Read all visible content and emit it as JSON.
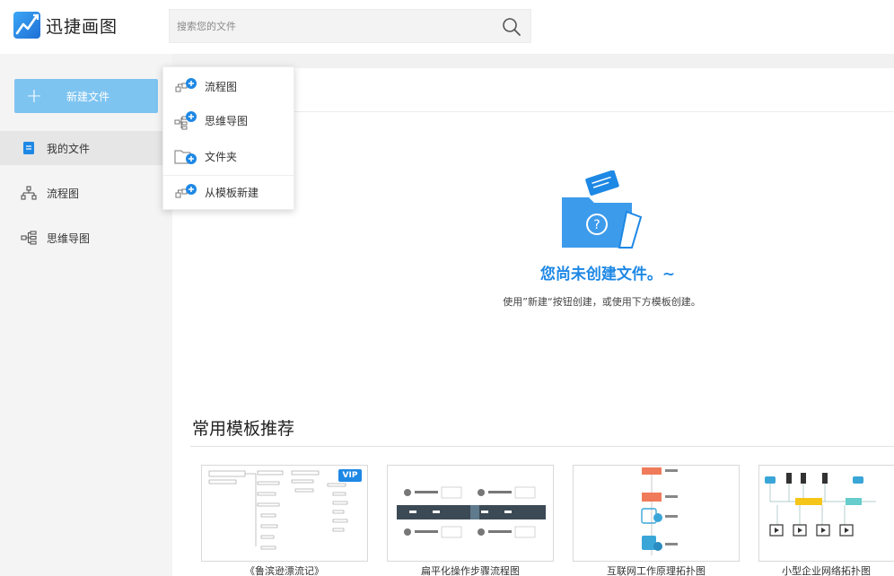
{
  "app": {
    "name": "迅捷画图"
  },
  "search": {
    "placeholder": "搜索您的文件"
  },
  "sidebar": {
    "new_button": "新建文件",
    "items": [
      {
        "label": "我的文件",
        "icon": "file-icon",
        "active": true
      },
      {
        "label": "流程图",
        "icon": "flowchart-icon",
        "active": false
      },
      {
        "label": "思维导图",
        "icon": "mindmap-icon",
        "active": false
      }
    ]
  },
  "dropdown": {
    "items": [
      {
        "label": "流程图",
        "icon": "flowchart-add-icon"
      },
      {
        "label": "思维导图",
        "icon": "mindmap-add-icon"
      },
      {
        "label": "文件夹",
        "icon": "folder-add-icon"
      },
      {
        "label": "从模板新建",
        "icon": "template-add-icon"
      }
    ]
  },
  "empty_state": {
    "title": "您尚未创建文件。~",
    "subtitle": "使用”新建“按钮创建，或使用下方模板创建。"
  },
  "templates": {
    "section_title": "常用模板推荐",
    "items": [
      {
        "name": "《鲁滨逊漂流记》",
        "badge": "VIP"
      },
      {
        "name": "扁平化操作步骤流程图",
        "badge": ""
      },
      {
        "name": "互联网工作原理拓扑图",
        "badge": ""
      },
      {
        "name": "小型企业网络拓扑图",
        "badge": ""
      }
    ]
  },
  "colors": {
    "accent": "#1e88e5",
    "new_button": "#7ec4f1",
    "sidebar_bg": "#f4f4f4"
  }
}
